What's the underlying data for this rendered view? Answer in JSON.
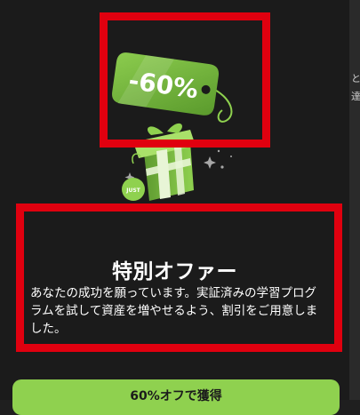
{
  "offer": {
    "discount_label": "-60%",
    "badge_text": "JUST",
    "title": "特別オファー",
    "description": "あなたの成功を願っています。実証済みの学習プログラムを試して資産を増やせるよう、割引をご用意しました。",
    "cta_label": "60%オフで獲得"
  },
  "background_edge": {
    "fragments": [
      "と",
      "達"
    ]
  },
  "colors": {
    "accent_green": "#8fd14f",
    "highlight_red": "#e0000f",
    "modal_background": "#1b1b1b"
  }
}
